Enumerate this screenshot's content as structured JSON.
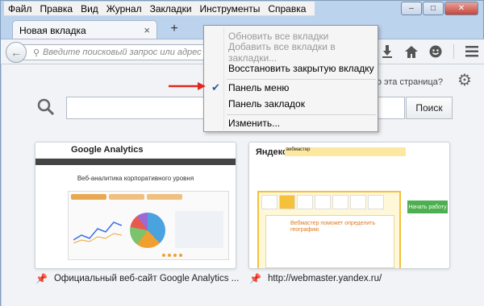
{
  "menubar": {
    "items": [
      "Файл",
      "Правка",
      "Вид",
      "Журнал",
      "Закладки",
      "Инструменты",
      "Справка"
    ]
  },
  "window_controls": {
    "minimize": "–",
    "maximize": "□",
    "close": "✕"
  },
  "tab": {
    "title": "Новая вкладка",
    "close": "×",
    "new_tab": "+"
  },
  "navbar": {
    "url_placeholder": "Введите поисковый запрос или адрес",
    "icons": [
      "download-icon",
      "home-icon",
      "hello-icon",
      "menu-icon"
    ]
  },
  "content": {
    "what_is_this": "о эта страница?",
    "search_button": "Поиск"
  },
  "context_menu": {
    "items": [
      {
        "label": "Обновить все вкладки",
        "disabled": true
      },
      {
        "label": "Добавить все вкладки в закладки...",
        "disabled": true
      },
      {
        "label": "Восстановить закрытую вкладку",
        "disabled": false
      },
      {
        "label": "Панель меню",
        "checked": true
      },
      {
        "label": "Панель закладок",
        "checked": false
      },
      {
        "label": "Изменить...",
        "disabled": false
      }
    ]
  },
  "tiles": [
    {
      "caption": "Официальный веб-сайт Google Analytics ...",
      "thumb_logo_text": "Google Analytics",
      "thumb_title": "Веб-аналитика корпоративного уровня"
    },
    {
      "caption": "http://webmaster.yandex.ru/",
      "thumb_logo_text": "Яндекс",
      "thumb_search": "вебмастер",
      "thumb_headline": "Вебмастер поможет определить географию",
      "thumb_button": "Начать работу"
    }
  ],
  "colors": {
    "window_frame": "#bcd3ee",
    "arrow": "#e0261e",
    "checkmark": "#2c5aa0"
  }
}
